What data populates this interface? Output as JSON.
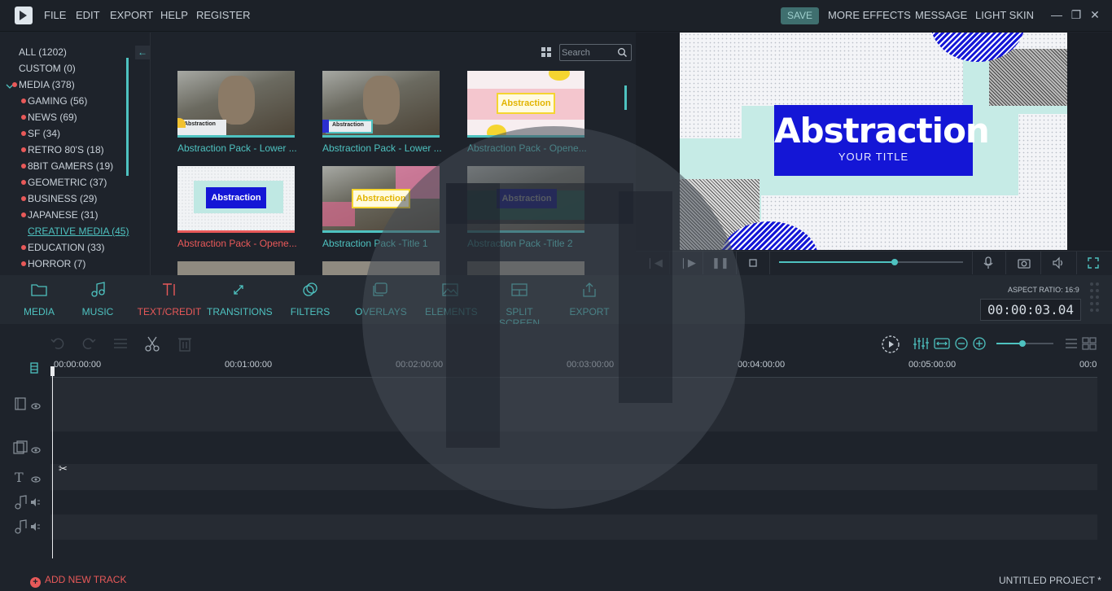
{
  "menubar": {
    "items": [
      "FILE",
      "EDIT",
      "EXPORT",
      "HELP",
      "REGISTER"
    ],
    "save_label": "SAVE",
    "right_items": [
      "MORE EFFECTS",
      "MESSAGE",
      "LIGHT SKIN"
    ]
  },
  "categories": [
    {
      "label": "ALL (1202)"
    },
    {
      "label": "CUSTOM (0)"
    },
    {
      "label": "MEDIA (378)"
    },
    {
      "label": "GAMING (56)"
    },
    {
      "label": "NEWS (69)"
    },
    {
      "label": "SF (34)"
    },
    {
      "label": "RETRO 80'S (18)"
    },
    {
      "label": "8BIT GAMERS (19)"
    },
    {
      "label": "GEOMETRIC (37)"
    },
    {
      "label": "BUSINESS (29)"
    },
    {
      "label": "JAPANESE (31)"
    },
    {
      "label": "CREATIVE MEDIA (45)"
    },
    {
      "label": "EDUCATION (33)"
    },
    {
      "label": "HORROR (7)"
    }
  ],
  "search": {
    "placeholder": "Search"
  },
  "thumbnails": [
    {
      "label": "Abstraction Pack - Lower ...",
      "badge": "Abstraction"
    },
    {
      "label": "Abstraction Pack - Lower ...",
      "badge": "Abstraction"
    },
    {
      "label": "Abstraction Pack - Opene...",
      "badge": "Abstraction"
    },
    {
      "label": "Abstraction Pack - Opene...",
      "badge": "Abstraction"
    },
    {
      "label": "Abstraction Pack -Title 1",
      "badge": "Abstraction"
    },
    {
      "label": "Abstraction Pack -Title 2",
      "badge": "Abstraction"
    }
  ],
  "preview": {
    "title": "Abstraction",
    "subtitle": "YOUR TITLE",
    "progress": 0.63
  },
  "toolbar": {
    "items": [
      "MEDIA",
      "MUSIC",
      "TEXT/CREDIT",
      "TRANSITIONS",
      "FILTERS",
      "OVERLAYS",
      "ELEMENTS",
      "SPLIT SCREEN",
      "EXPORT"
    ],
    "aspect_ratio": "ASPECT RATIO: 16:9",
    "timecode": "00:00:03.04"
  },
  "timeline": {
    "ruler": [
      "00:00:00:00",
      "00:01:00:00",
      "00:02:00:00",
      "00:03:00:00",
      "00:04:00:00",
      "00:05:00:00",
      "00:0"
    ],
    "add_track": "ADD NEW TRACK",
    "project_name": "UNTITLED PROJECT *"
  },
  "colors": {
    "accent": "#4ec2c0",
    "active": "#e85959",
    "background": "#1e232b",
    "preview_box": "#1416d6"
  }
}
